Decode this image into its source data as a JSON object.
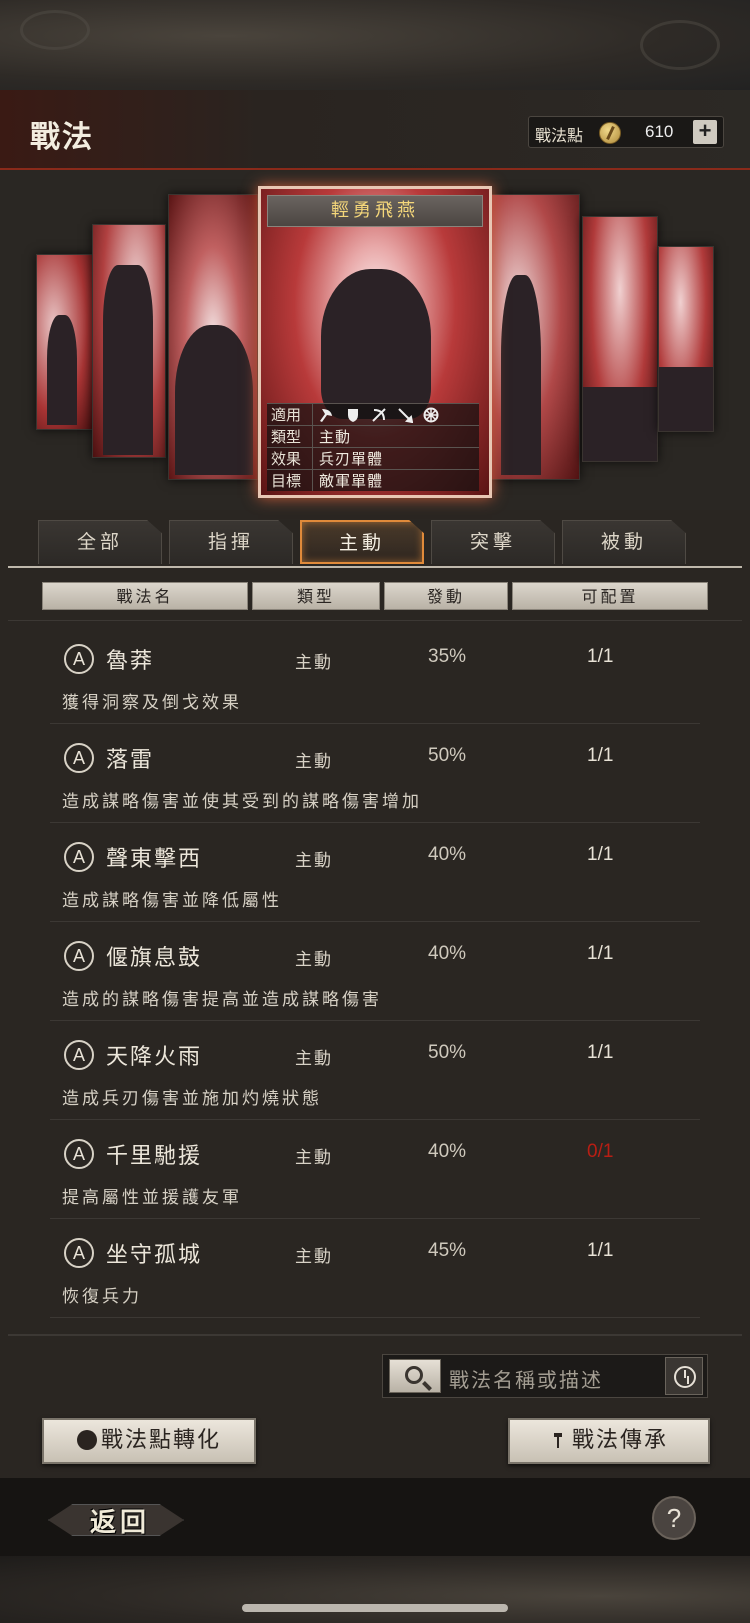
{
  "header": {
    "title": "戰法",
    "points_label": "戰法點",
    "points_value": "610",
    "add_label": "+"
  },
  "featured_card": {
    "name": "輕勇飛燕",
    "rows": [
      {
        "key": "適用",
        "value": ""
      },
      {
        "key": "類型",
        "value": "主動"
      },
      {
        "key": "效果",
        "value": "兵刃單體"
      },
      {
        "key": "目標",
        "value": "敵軍單體"
      }
    ],
    "applicable_icons": [
      "axe-icon",
      "shield-icon",
      "bow-icon",
      "spear-icon",
      "wheel-icon"
    ]
  },
  "tabs": [
    {
      "label": "全部"
    },
    {
      "label": "指揮"
    },
    {
      "label": "主動",
      "active": true
    },
    {
      "label": "突擊"
    },
    {
      "label": "被動"
    }
  ],
  "columns": [
    "戰法名",
    "類型",
    "發動",
    "可配置"
  ],
  "tactics": [
    {
      "grade": "A",
      "name": "魯莽",
      "type": "主動",
      "rate": "35%",
      "config": "1/1",
      "desc": "獲得洞察及倒戈效果"
    },
    {
      "grade": "A",
      "name": "落雷",
      "type": "主動",
      "rate": "50%",
      "config": "1/1",
      "desc": "造成謀略傷害並使其受到的謀略傷害增加"
    },
    {
      "grade": "A",
      "name": "聲東擊西",
      "type": "主動",
      "rate": "40%",
      "config": "1/1",
      "desc": "造成謀略傷害並降低屬性"
    },
    {
      "grade": "A",
      "name": "偃旗息鼓",
      "type": "主動",
      "rate": "40%",
      "config": "1/1",
      "desc": "造成的謀略傷害提高並造成謀略傷害"
    },
    {
      "grade": "A",
      "name": "天降火雨",
      "type": "主動",
      "rate": "50%",
      "config": "1/1",
      "desc": "造成兵刃傷害並施加灼燒狀態"
    },
    {
      "grade": "A",
      "name": "千里馳援",
      "type": "主動",
      "rate": "40%",
      "config": "0/1",
      "desc": "提高屬性並援護友軍"
    },
    {
      "grade": "A",
      "name": "坐守孤城",
      "type": "主動",
      "rate": "45%",
      "config": "1/1",
      "desc": "恢復兵力"
    }
  ],
  "search": {
    "placeholder": "戰法名稱或描述"
  },
  "buttons": {
    "convert": "戰法點轉化",
    "inherit": "戰法傳承",
    "back": "返回",
    "help": "?"
  },
  "colors": {
    "accent_orange": "#e08a3a",
    "unavailable_red": "#b81e14"
  }
}
